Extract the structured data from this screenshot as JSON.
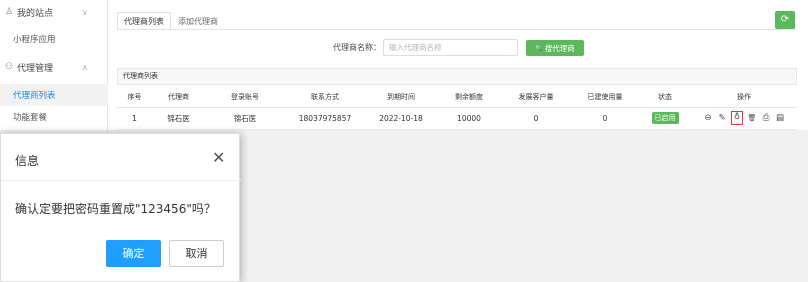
{
  "sidebar": {
    "group_site": "我的站点",
    "group_agent": "代理管理",
    "items": [
      {
        "label": "小程序应用"
      },
      {
        "label": "代理商列表"
      },
      {
        "label": "功能套餐"
      }
    ]
  },
  "tabs": [
    {
      "label": "代理商列表"
    },
    {
      "label": "添加代理商"
    }
  ],
  "refresh_icon": "⟳",
  "search": {
    "label": "代理商名称：",
    "placeholder": "输入代理商名称",
    "button_label": "搜代理商",
    "button_icon": "🔍"
  },
  "panel_title": "代理商列表",
  "table": {
    "headers": [
      "序号",
      "代理商",
      "登录账号",
      "联系方式",
      "到期时间",
      "剩余额度",
      "发展客户量",
      "已建使用量",
      "状态",
      "操作"
    ],
    "rows": [
      {
        "index": "1",
        "agent": "锦石医",
        "account": "锦石医",
        "contact": "18037975857",
        "expire": "2022-10-18",
        "remaining": "10000",
        "customers": "0",
        "used": "0",
        "status": "已启用"
      }
    ]
  },
  "op_icons": {
    "view": "⊖",
    "edit": "✎",
    "reset_password": "♁",
    "delete": "🗑",
    "print": "⎙",
    "detail": "▤"
  },
  "dialog": {
    "title": "信息",
    "close": "✕",
    "message": "确认定要把密码重置成\"123456\"吗？",
    "ok": "确定",
    "cancel": "取消"
  },
  "colors": {
    "accent": "#1e9fff",
    "green": "#5cb85c",
    "highlight": "#e53935"
  }
}
